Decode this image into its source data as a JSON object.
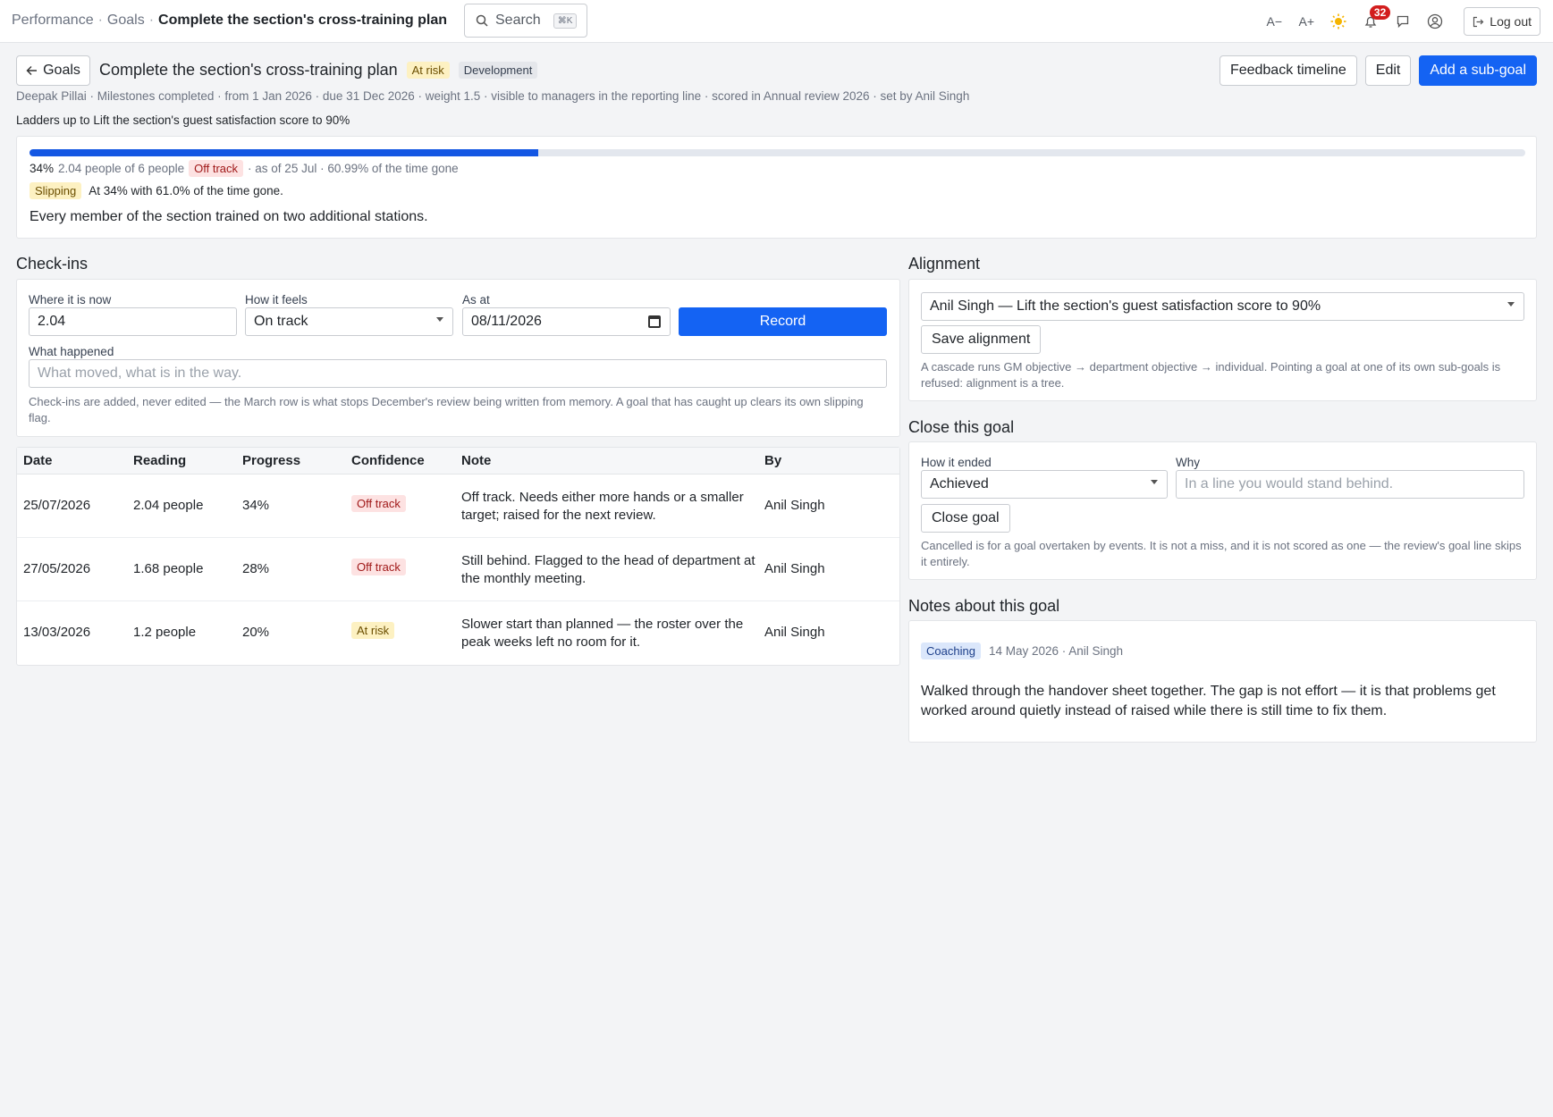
{
  "breadcrumb": {
    "items": [
      "Performance",
      "Goals"
    ],
    "current": "Complete the section's cross-training plan"
  },
  "search": {
    "label": "Search",
    "shortcut": "⌘K"
  },
  "topbar": {
    "font_smaller": "A−",
    "font_larger": "A+",
    "notification_count": "32",
    "logout_label": "Log out"
  },
  "header": {
    "back_label": "Goals",
    "title": "Complete the section's cross-training plan",
    "status_tag": "At risk",
    "type_tag": "Development",
    "actions": {
      "feedback": "Feedback timeline",
      "edit": "Edit",
      "add_sub_goal": "Add a sub-goal"
    },
    "meta": "Deepak Pillai · Milestones completed · from 1 Jan 2026 · due 31 Dec 2026 · weight 1.5 · visible to managers in the reporting line · scored in Annual review 2026 · set by Anil Singh",
    "ladders_up": "Ladders up to Lift the section's guest satisfaction score to 90%"
  },
  "progress": {
    "percent_value": 34,
    "percent_label": "34%",
    "amount": "2.04 people of 6 people",
    "status_tag": "Off track",
    "as_of": "· as of 25 Jul · 60.99% of the time gone",
    "slipping_tag": "Slipping",
    "slipping_text": "At 34% with 61.0% of the time gone.",
    "description": "Every member of the section trained on two additional stations."
  },
  "checkins": {
    "heading": "Check-ins",
    "where_label": "Where it is now",
    "where_value": "2.04",
    "feels_label": "How it feels",
    "feels_value": "On track",
    "asat_label": "As at",
    "asat_value": "08/11/2026",
    "record_label": "Record",
    "happened_label": "What happened",
    "happened_placeholder": "What moved, what is in the way.",
    "help": "Check-ins are added, never edited — the March row is what stops December's review being written from memory. A goal that has caught up clears its own slipping flag.",
    "columns": [
      "Date",
      "Reading",
      "Progress",
      "Confidence",
      "Note",
      "By"
    ],
    "rows": [
      {
        "date": "25/07/2026",
        "reading": "2.04 people",
        "progress": "34%",
        "confidence": "Off track",
        "confidence_color": "#fde2e2",
        "note": "Off track. Needs either more hands or a smaller target; raised for the next review.",
        "by": "Anil Singh"
      },
      {
        "date": "27/05/2026",
        "reading": "1.68 people",
        "progress": "28%",
        "confidence": "Off track",
        "confidence_color": "#fde2e2",
        "note": "Still behind. Flagged to the head of department at the monthly meeting.",
        "by": "Anil Singh"
      },
      {
        "date": "13/03/2026",
        "reading": "1.2 people",
        "progress": "20%",
        "confidence": "At risk",
        "confidence_color": "#fdf1c2",
        "note": "Slower start than planned — the roster over the peak weeks left no room for it.",
        "by": "Anil Singh"
      }
    ]
  },
  "alignment": {
    "heading": "Alignment",
    "selected": "Anil Singh — Lift the section's guest satisfaction score to 90%",
    "save_label": "Save alignment",
    "help": "A cascade runs GM objective → department objective → individual. Pointing a goal at one of its own sub-goals is refused: alignment is a tree."
  },
  "close": {
    "heading": "Close this goal",
    "ended_label": "How it ended",
    "ended_value": "Achieved",
    "why_label": "Why",
    "why_placeholder": "In a line you would stand behind.",
    "button_label": "Close goal",
    "help": "Cancelled is for a goal overtaken by events. It is not a miss, and it is not scored as one — the review's goal line skips it entirely."
  },
  "notes": {
    "heading": "Notes about this goal",
    "tag": "Coaching",
    "meta": "14 May 2026 · Anil Singh",
    "body": "Walked through the handover sheet together. The gap is not effort — it is that problems get worked around quietly instead of raised while there is still time to fix them."
  },
  "colors": {
    "primary": "#1463f3",
    "progress_fill": "#1457e3",
    "danger": "#d21d1d"
  }
}
